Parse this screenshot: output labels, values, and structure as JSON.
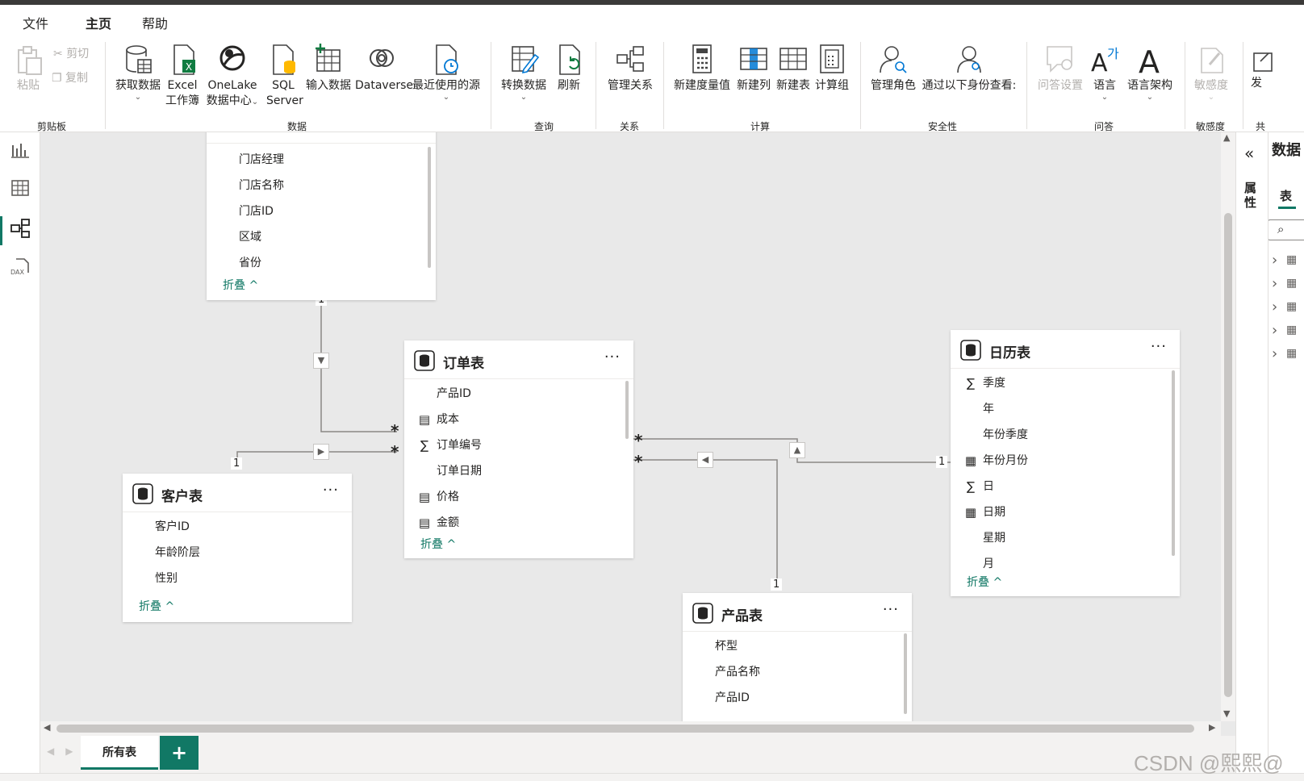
{
  "menu": {
    "file": "文件",
    "home": "主页",
    "help": "帮助"
  },
  "ribbon": {
    "clipboard": {
      "paste": "粘贴",
      "cut": "剪切",
      "copy": "复制",
      "label": "剪贴板"
    },
    "data": {
      "get_data": "获取数据",
      "excel_l1": "Excel",
      "excel_l2": "工作簿",
      "onelake_l1": "OneLake",
      "onelake_l2": "数据中心",
      "sql_l1": "SQL",
      "sql_l2": "Server",
      "enter_data": "输入数据",
      "dataverse": "Dataverse",
      "recent": "最近使用的源",
      "label": "数据"
    },
    "query": {
      "transform": "转换数据",
      "refresh": "刷新",
      "label": "查询"
    },
    "relationships": {
      "manage": "管理关系",
      "label": "关系"
    },
    "calculations": {
      "new_measure": "新建度量值",
      "new_column": "新建列",
      "new_table": "新建表",
      "calc_group": "计算组",
      "label": "计算"
    },
    "security": {
      "manage_roles": "管理角色",
      "view_as": "通过以下身份查看:",
      "label": "安全性"
    },
    "qa": {
      "settings": "问答设置",
      "language": "语言",
      "schema": "语言架构",
      "label": "问答"
    },
    "sensitivity": {
      "btn": "敏感度",
      "label": "敏感度"
    },
    "share": {
      "btn": "发",
      "label": "共"
    }
  },
  "tables": {
    "store": {
      "fields": [
        "门店经理",
        "门店名称",
        "门店ID",
        "区域",
        "省份"
      ],
      "collapse": "折叠 ^"
    },
    "orders": {
      "title": "订单表",
      "fields": [
        "产品ID",
        "成本",
        "订单编号",
        "订单日期",
        "价格",
        "金额"
      ],
      "collapse": "折叠 ^"
    },
    "customers": {
      "title": "客户表",
      "fields": [
        "客户ID",
        "年龄阶层",
        "性别"
      ],
      "collapse": "折叠 ^"
    },
    "calendar": {
      "title": "日历表",
      "fields": [
        "季度",
        "年",
        "年份季度",
        "年份月份",
        "日",
        "日期",
        "星期",
        "月"
      ],
      "collapse": "折叠 ^"
    },
    "products": {
      "title": "产品表",
      "fields": [
        "杯型",
        "产品名称",
        "产品ID"
      ]
    }
  },
  "relationship_marks": {
    "many": "*",
    "one": "1"
  },
  "bottom": {
    "all_tables": "所有表",
    "add": "+"
  },
  "right": {
    "properties": "属性",
    "data_title": "数据",
    "tab_tables": "表"
  },
  "watermark": "CSDN @熙熙@",
  "colors": {
    "accent": "#117865"
  }
}
